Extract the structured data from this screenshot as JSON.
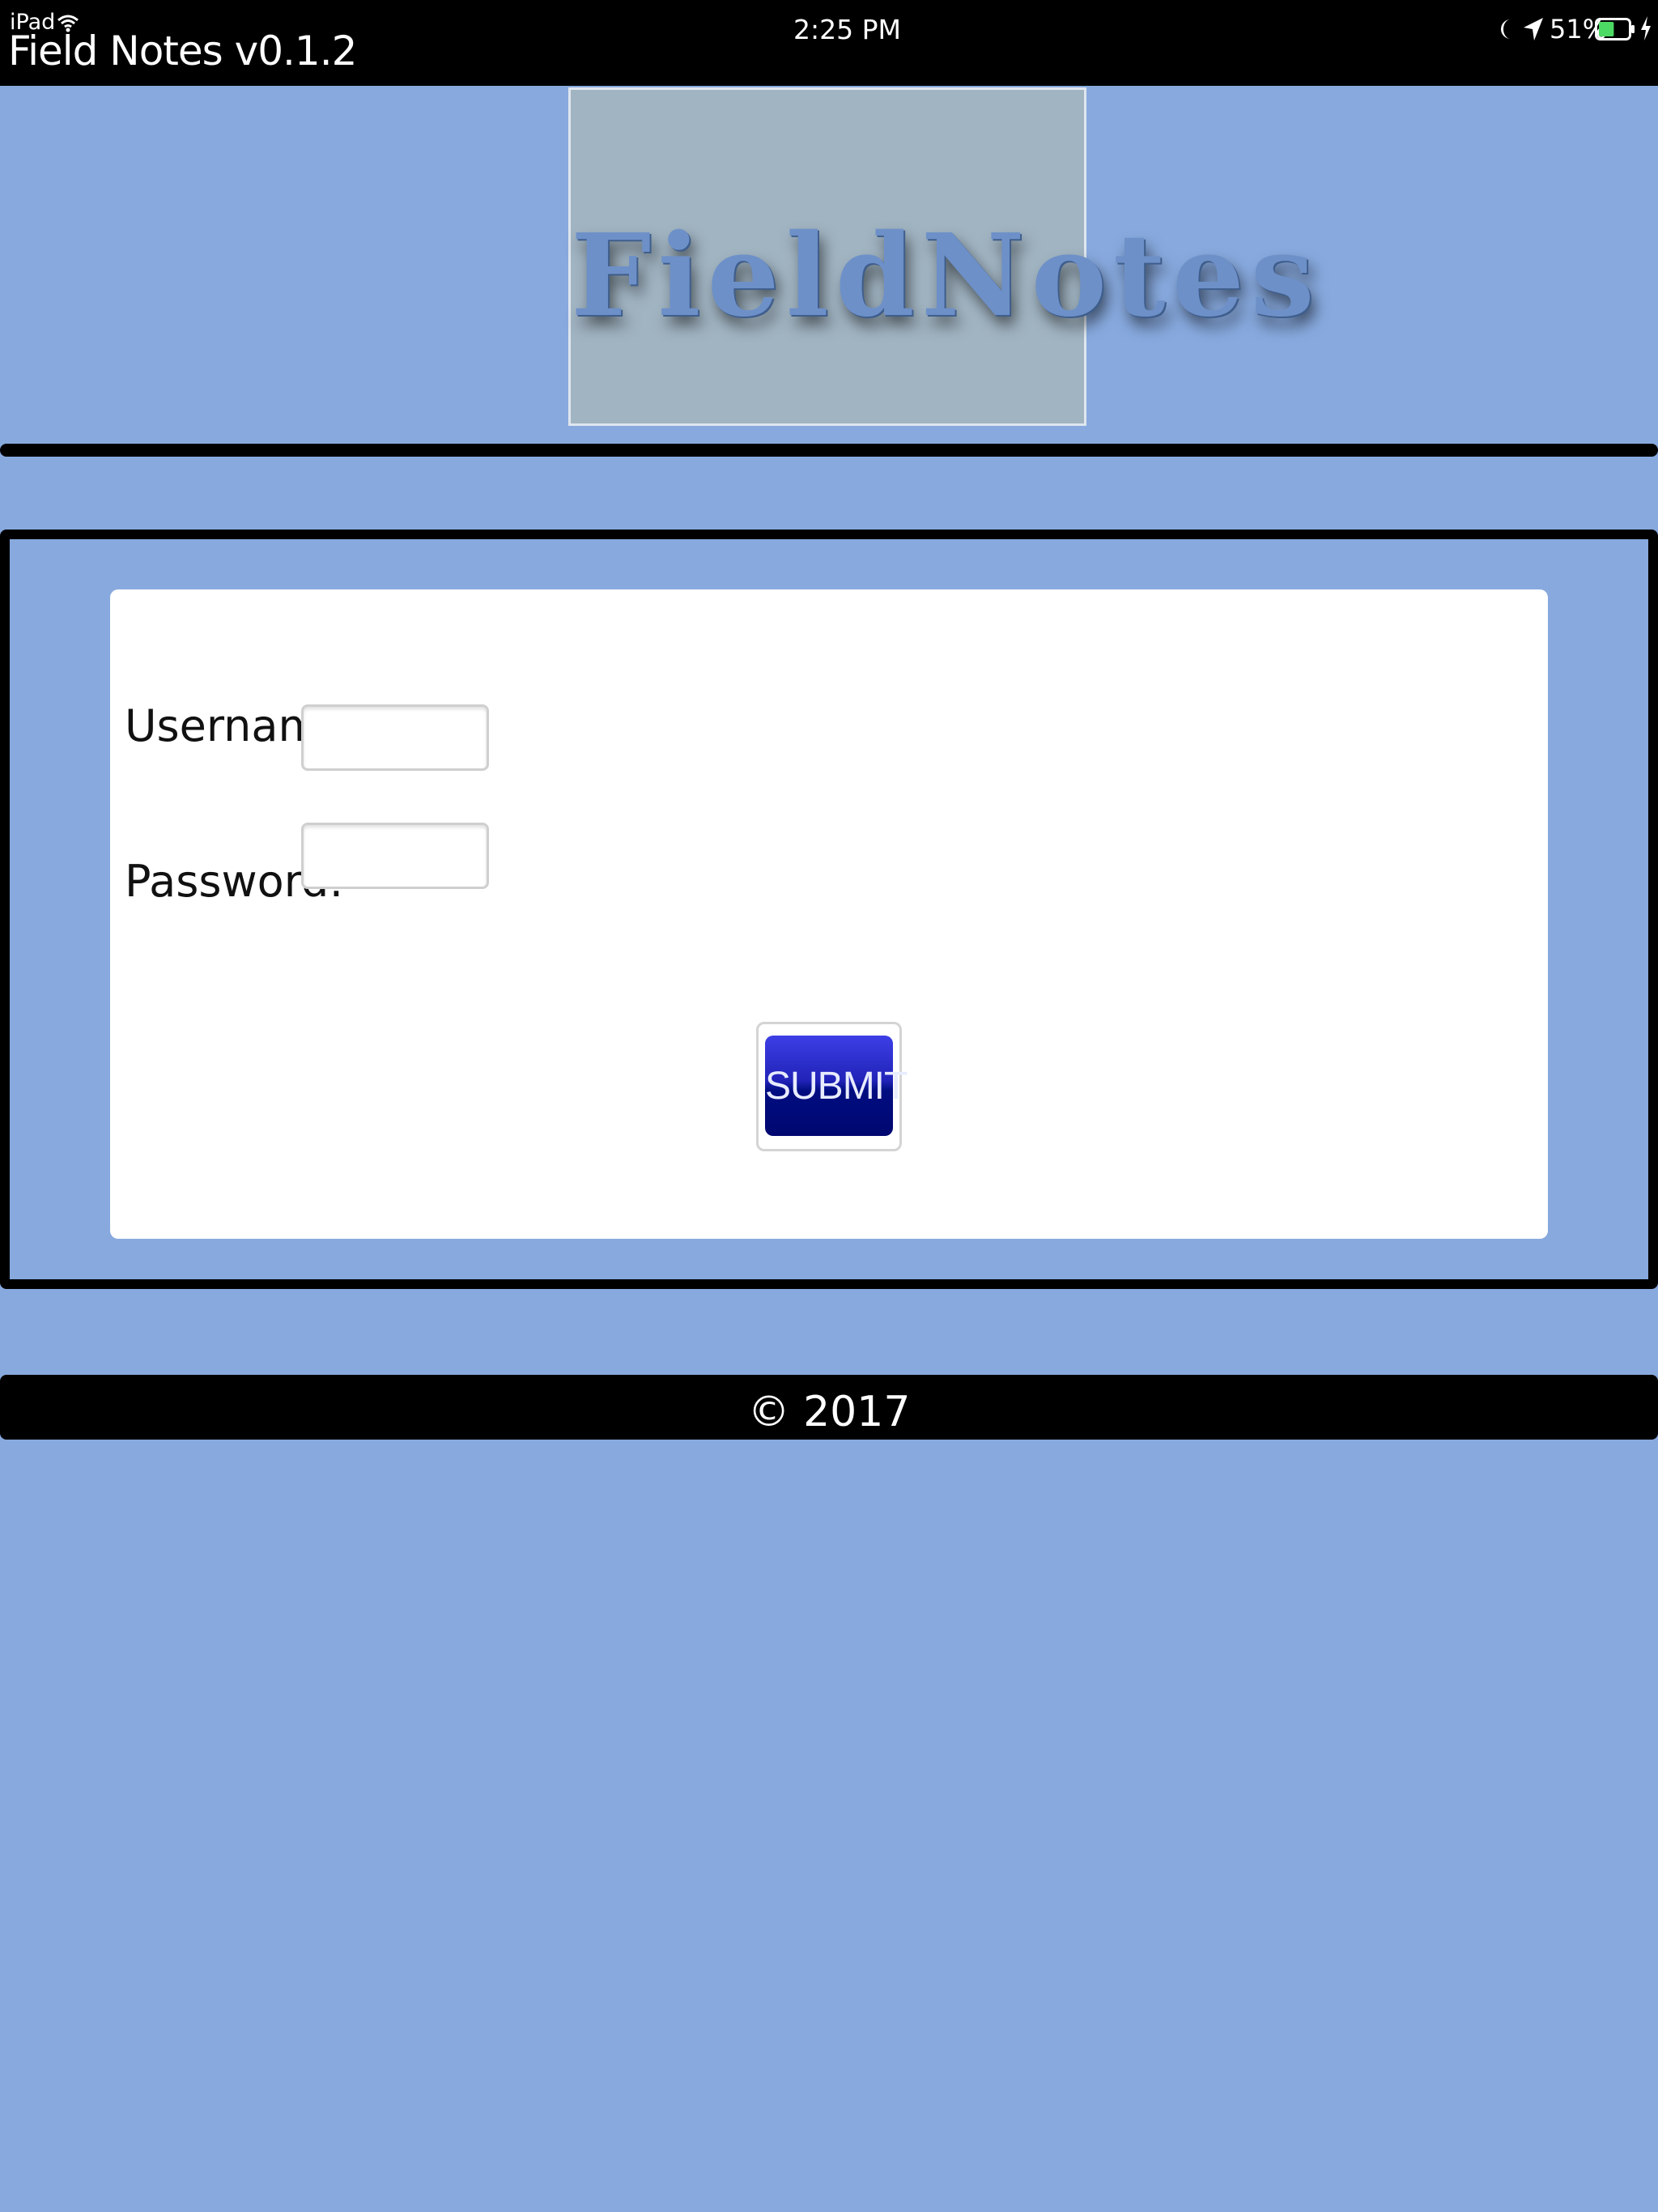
{
  "status_bar": {
    "device": "iPad",
    "app_title": "Field Notes v0.1.2",
    "time": "2:25 PM",
    "battery_percent": "51%",
    "battery_level": 0.51,
    "icons": [
      "wifi-icon",
      "moon-icon",
      "location-arrow-icon",
      "battery-icon",
      "charging-bolt-icon"
    ]
  },
  "logo": {
    "text": "FieldNotes"
  },
  "login_form": {
    "username_label": "Username:",
    "password_label": "Password:",
    "username_value": "",
    "password_value": "",
    "submit_label": "SUBMIT"
  },
  "footer": {
    "copyright": "© 2017"
  },
  "colors": {
    "background": "#87a9de",
    "status_bar": "#000000",
    "logo_box": "#a1b4c2",
    "logo_text": "#6d90c8",
    "form_card": "#ffffff",
    "submit_button": "#1b1dc0"
  }
}
